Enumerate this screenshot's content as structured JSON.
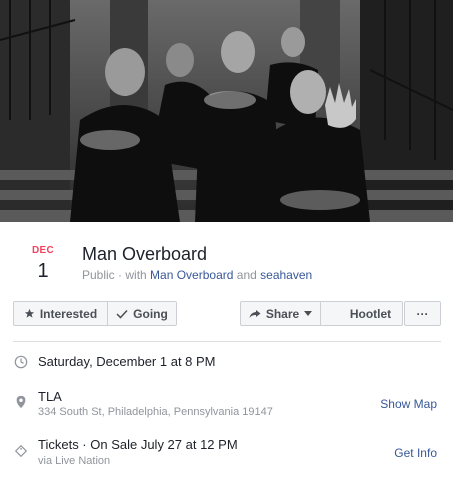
{
  "event": {
    "date": {
      "month": "DEC",
      "day": "1"
    },
    "title": "Man Overboard",
    "privacy": "Public",
    "with_prefix": "with",
    "hosts": [
      "Man Overboard",
      "seahaven"
    ],
    "and": "and"
  },
  "actions": {
    "interested": "Interested",
    "going": "Going",
    "share": "Share",
    "hootlet": "Hootlet",
    "more": "···"
  },
  "details": {
    "datetime": "Saturday, December 1 at 8 PM",
    "venue": "TLA",
    "address": "334 South St, Philadelphia, Pennsylvania 19147",
    "map_link": "Show Map",
    "tickets": "Tickets · On Sale July 27 at 12 PM",
    "ticket_source": "via Live Nation",
    "info_link": "Get Info"
  },
  "colors": {
    "date_month": "#f3425f",
    "link": "#385898",
    "muted_text": "#90949c",
    "button_bg": "#f5f6f7",
    "button_border": "#ccd0d5"
  }
}
